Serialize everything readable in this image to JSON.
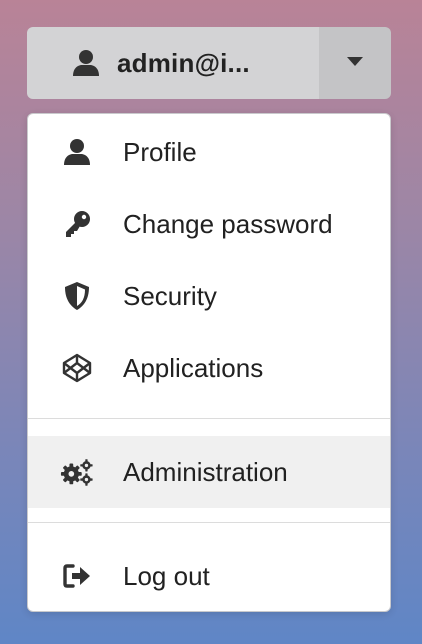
{
  "user": {
    "name": "admin@i...",
    "icon": "user-icon",
    "caret_icon": "caret-down-icon"
  },
  "menu": {
    "items": [
      {
        "label": "Profile",
        "icon": "user-icon"
      },
      {
        "label": "Change password",
        "icon": "key-icon"
      },
      {
        "label": "Security",
        "icon": "shield-icon"
      },
      {
        "label": "Applications",
        "icon": "codepen-icon"
      },
      {
        "label": "Administration",
        "icon": "cogs-icon"
      },
      {
        "label": "Log out",
        "icon": "sign-out-icon"
      }
    ]
  },
  "colors": {
    "text": "#212121",
    "active_bg": "#f0f0f0"
  }
}
